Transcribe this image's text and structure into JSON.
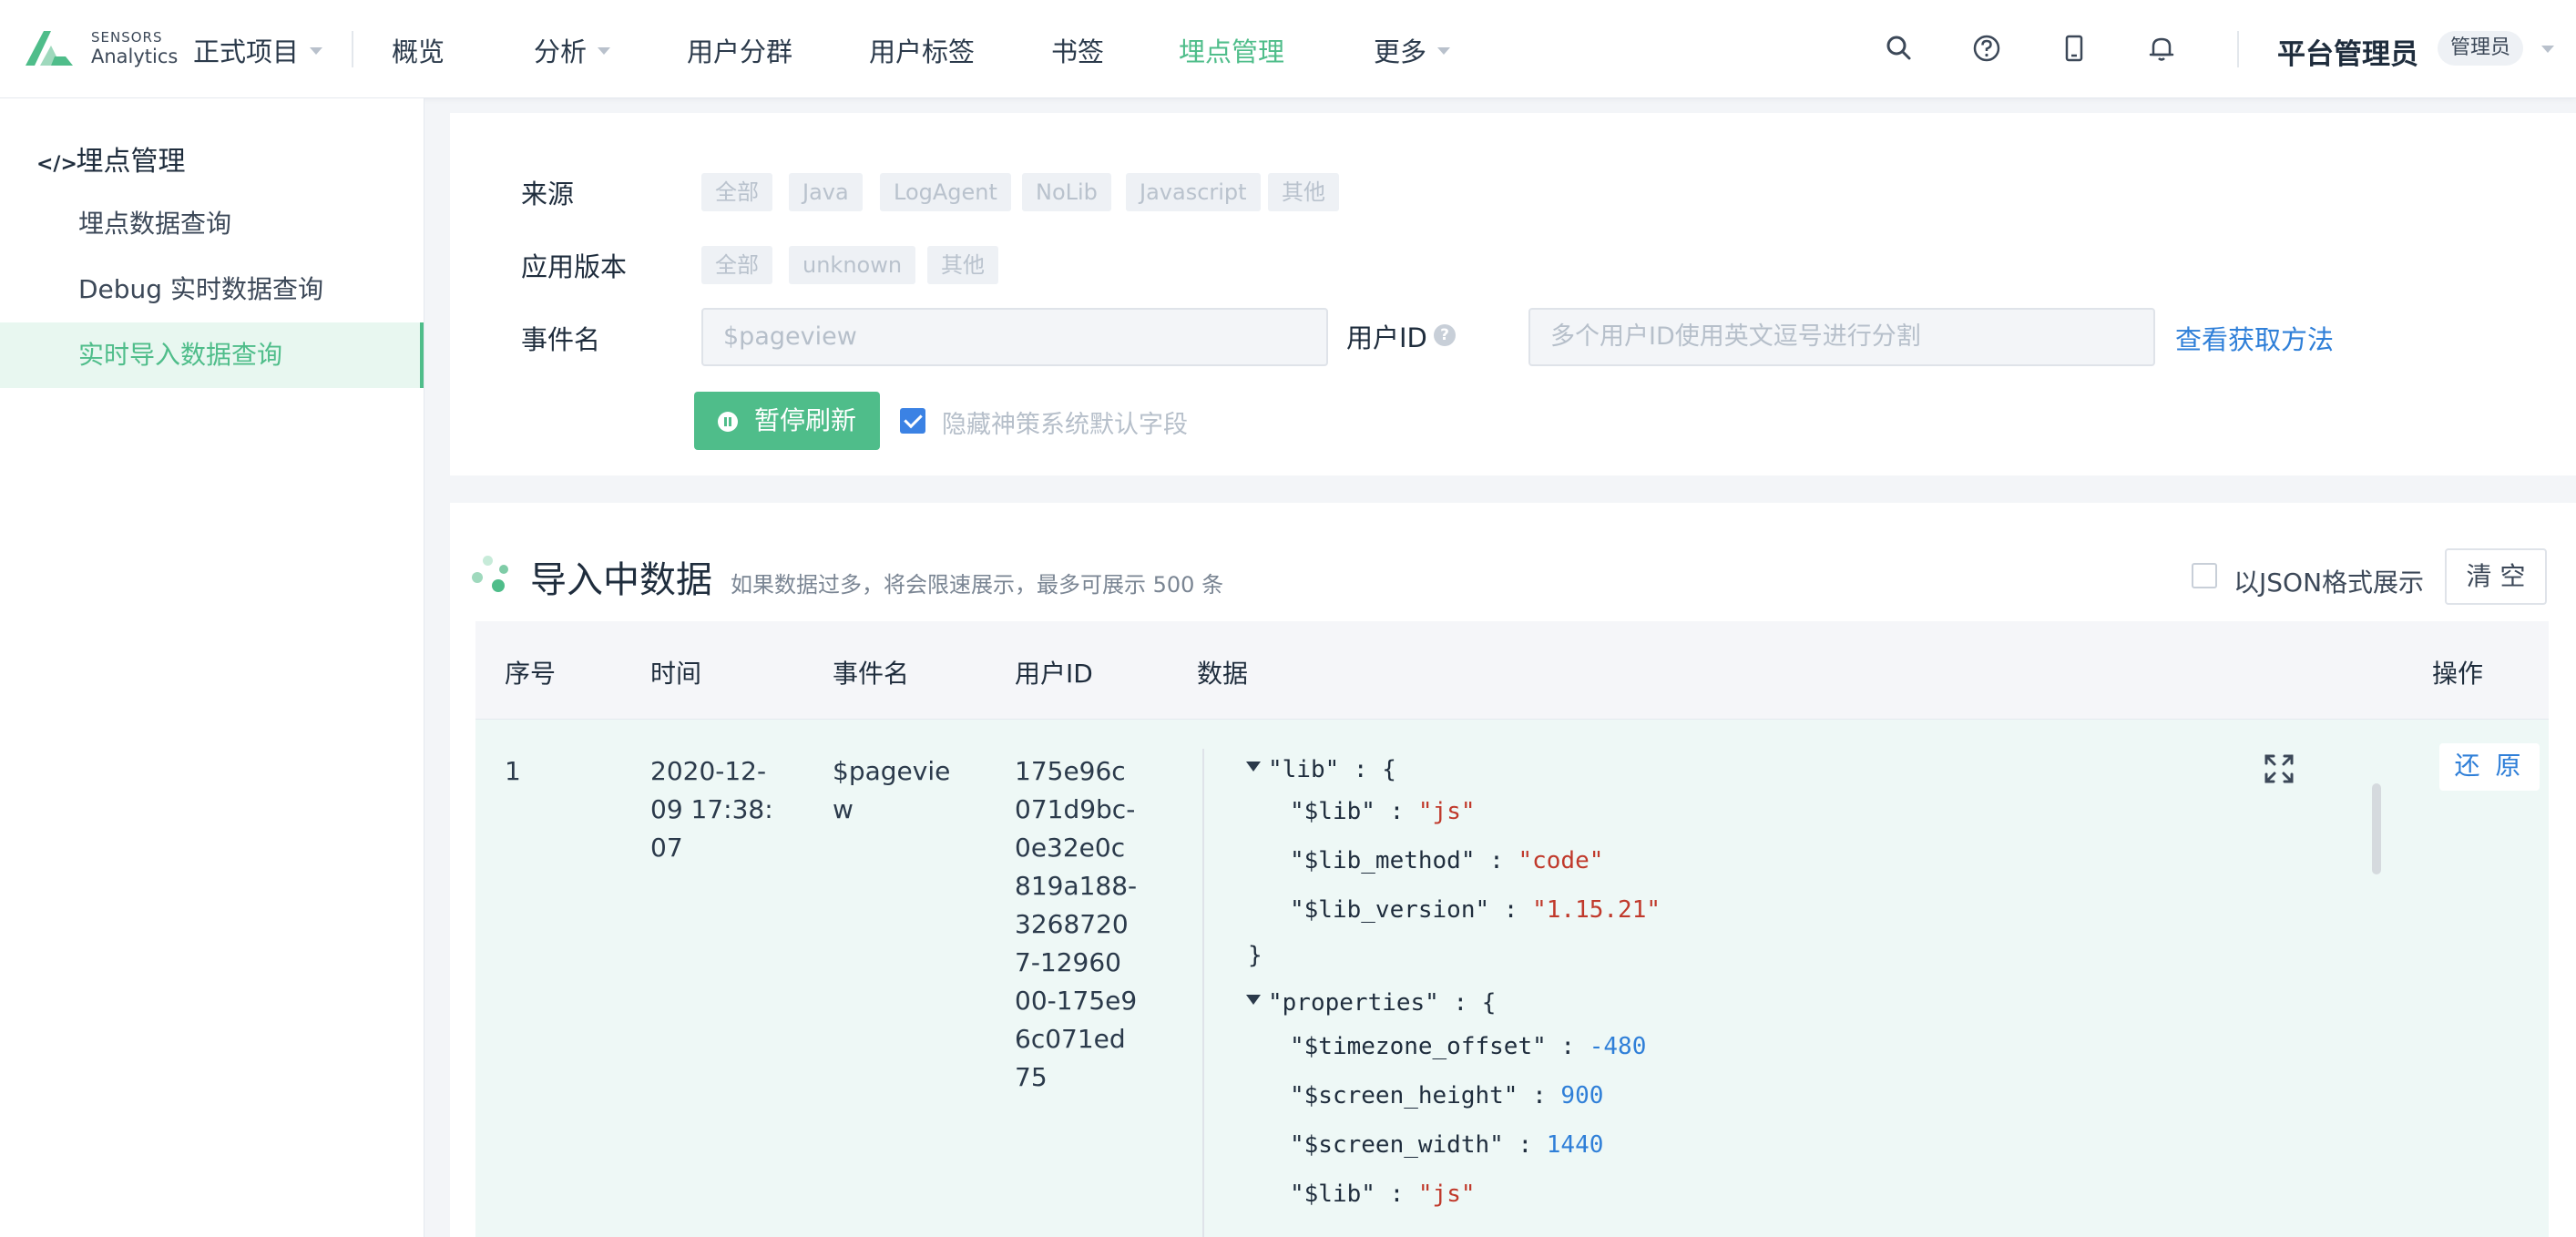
{
  "brand": {
    "line1": "SENSORS",
    "line2": "Analytics"
  },
  "header": {
    "project": "正式项目",
    "nav": [
      "概览",
      "分析",
      "用户分群",
      "用户标签",
      "书签",
      "埋点管理",
      "更多"
    ],
    "active_nav": "埋点管理",
    "user_name": "平台管理员",
    "user_role": "管理员"
  },
  "sidebar": {
    "title": "埋点管理",
    "items": [
      "埋点数据查询",
      "Debug 实时数据查询",
      "实时导入数据查询"
    ],
    "active_item": "实时导入数据查询"
  },
  "filters": {
    "source_label": "来源",
    "source_options": [
      "全部",
      "Java",
      "LogAgent",
      "NoLib",
      "Javascript",
      "其他"
    ],
    "version_label": "应用版本",
    "version_options": [
      "全部",
      "unknown",
      "其他"
    ],
    "event_label": "事件名",
    "event_placeholder": "$pageview",
    "user_id_label": "用户ID",
    "user_id_placeholder": "多个用户ID使用英文逗号进行分割",
    "help_link": "查看获取方法",
    "pause_button": "暂停刷新",
    "hide_fields_label": "隐藏神策系统默认字段",
    "hide_fields_checked": true
  },
  "importing": {
    "title": "导入中数据",
    "subtitle": "如果数据过多，将会限速展示，最多可展示 500 条",
    "json_toggle_label": "以JSON格式展示",
    "json_toggle_checked": false,
    "clear_button": "清 空",
    "columns": [
      "序号",
      "时间",
      "事件名",
      "用户ID",
      "数据",
      "操作"
    ],
    "rows": [
      {
        "index": "1",
        "time_lines": [
          "2020-12-",
          "09 17:38:",
          "07"
        ],
        "event_lines": [
          "$pagevie",
          "w"
        ],
        "user_id_lines": [
          "175e96c",
          "071d9bc-",
          "0e32e0c",
          "819a188-",
          "3268720",
          "7-12960",
          "00-175e9",
          "6c071ed",
          "75"
        ],
        "restore_button": "还 原"
      }
    ],
    "json": {
      "lib_key": "\"lib\"",
      "lib_entries": [
        {
          "key": "\"$lib\"",
          "value": "\"js\"",
          "type": "string"
        },
        {
          "key": "\"$lib_method\"",
          "value": "\"code\"",
          "type": "string"
        },
        {
          "key": "\"$lib_version\"",
          "value": "\"1.15.21\"",
          "type": "string"
        }
      ],
      "properties_key": "\"properties\"",
      "properties_entries": [
        {
          "key": "\"$timezone_offset\"",
          "value": "-480",
          "type": "number"
        },
        {
          "key": "\"$screen_height\"",
          "value": "900",
          "type": "number"
        },
        {
          "key": "\"$screen_width\"",
          "value": "1440",
          "type": "number"
        },
        {
          "key": "\"$lib\"",
          "value": "\"js\"",
          "type": "string"
        }
      ]
    }
  },
  "colors": {
    "accent": "#4fbd8a",
    "link": "#2f7fd8",
    "string": "#c0392b",
    "number": "#2f7fd8"
  }
}
